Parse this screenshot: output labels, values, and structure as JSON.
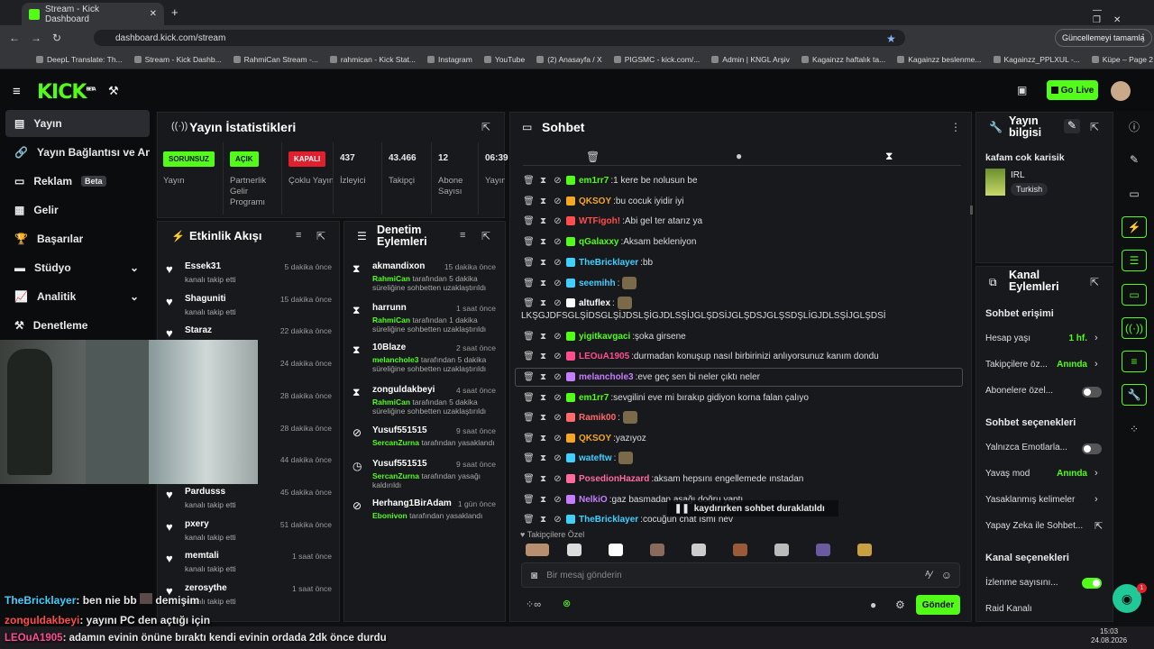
{
  "browser": {
    "tab_title": "Stream - Kick Dashboard",
    "url": "dashboard.kick.com/stream",
    "update_label": "Güncellemeyi tamamla",
    "bookmarks": [
      "DeepL Translate: Th...",
      "Stream - Kick Dashb...",
      "RahmiCan Stream -...",
      "rahmican - Kick Stat...",
      "Instagram",
      "YouTube",
      "(2) Anasayfa / X",
      "PIGSMC - kick.com/...",
      "Admin | KNGL Arşiv",
      "Kagainzz haftalık ta...",
      "Kagainzz beslenme...",
      "Kagainzz_PPLXUL -...",
      "Küpe – Page 2"
    ]
  },
  "kick": {
    "logo": "KICK",
    "beta": "BETA",
    "go_live": "Go Live"
  },
  "sidebar": {
    "items": [
      {
        "label": "Yayın"
      },
      {
        "label": "Yayın Bağlantısı ve Anahtarı"
      },
      {
        "label": "Reklam"
      },
      {
        "label": "Gelir"
      },
      {
        "label": "Başarılar"
      },
      {
        "label": "Stüdyo"
      },
      {
        "label": "Analitik"
      },
      {
        "label": "Denetleme"
      }
    ],
    "beta_badge": "Beta"
  },
  "stats": {
    "title": "Yayın İstatistikleri",
    "cols": [
      {
        "value": "SORUNSUZ",
        "label": "Yayın",
        "color": "#53fc18"
      },
      {
        "value": "AÇIK",
        "label": "Partnerlik Gelir Programı",
        "color": "#53fc18"
      },
      {
        "value": "KAPALI",
        "label": "Çoklu Yayın",
        "color": "#e0202d"
      },
      {
        "value": "437",
        "label": "İzleyici"
      },
      {
        "value": "43.466",
        "label": "Takipçi"
      },
      {
        "value": "12",
        "label": "Abone Sayısı"
      },
      {
        "value": "06:39",
        "label": "Yayın Oldu Süre"
      }
    ]
  },
  "activity": {
    "title": "Etkinlik Akışı",
    "items": [
      {
        "user": "Essek31",
        "action": "kanalı takip etti",
        "time": "5 dakika önce"
      },
      {
        "user": "Shaguniti",
        "action": "kanalı takip etti",
        "time": "15 dakika önce"
      },
      {
        "user": "Staraz",
        "action": "",
        "time": "22 dakika önce"
      },
      {
        "user": "",
        "action": "",
        "time": "24 dakika önce"
      },
      {
        "user": "",
        "action": "",
        "time": "28 dakika önce"
      },
      {
        "user": "",
        "action": "",
        "time": "28 dakika önce"
      },
      {
        "user": "",
        "action": "",
        "time": "44 dakika önce"
      },
      {
        "user": "Pardusss",
        "action": "kanalı takip etti",
        "time": "45 dakika önce"
      },
      {
        "user": "pxery",
        "action": "kanalı takip etti",
        "time": "51 dakika önce"
      },
      {
        "user": "memtali",
        "action": "kanalı takip etti",
        "time": "1 saat önce"
      },
      {
        "user": "zerosythe",
        "action": "kanalı takip etti",
        "time": "1 saat önce"
      }
    ]
  },
  "moderation": {
    "title": "Denetim Eylemleri",
    "items": [
      {
        "user": "akmandixon",
        "by": "RahmiCan",
        "rest": "tarafından 5 dakika süreliğine sohbetten uzaklaştırıldı",
        "time": "15 dakika önce",
        "icon": "⧗"
      },
      {
        "user": "harrunn",
        "by": "RahmiCan",
        "rest": "tarafından 1 dakika süreliğine sohbetten uzaklaştırıldı",
        "time": "1 saat önce",
        "icon": "⧗"
      },
      {
        "user": "10Blaze",
        "by": "melanchole3",
        "rest": "tarafından 5 dakika süreliğine sohbetten uzaklaştırıldı",
        "time": "2 saat önce",
        "icon": "⧗"
      },
      {
        "user": "zonguldakbeyi",
        "by": "RahmiCan",
        "rest": "tarafından 5 dakika süreliğine sohbetten uzaklaştırıldı",
        "time": "4 saat önce",
        "icon": "⧗"
      },
      {
        "user": "Yusuf551515",
        "by": "SercanZurna",
        "rest": "tarafından yasaklandı",
        "time": "9 saat önce",
        "icon": "⊘"
      },
      {
        "user": "Yusuf551515",
        "by": "SercanZurna",
        "rest": "tarafından yasağı kaldırıldı",
        "time": "9 saat önce",
        "icon": "◷"
      },
      {
        "user": "Herhang1BirAdam",
        "by": "Ebonivon",
        "rest": "tarafından yasaklandı",
        "time": "1 gün önce",
        "icon": "⊘"
      }
    ]
  },
  "chat": {
    "title": "Sohbet",
    "messages": [
      {
        "user": "em1rr7",
        "text": "1 kere be nolusun be",
        "color": "#53fc18"
      },
      {
        "user": "QKSOY",
        "text": "bu cocuk iyidir iyi",
        "color": "#f5a623"
      },
      {
        "user": "WTFigoh!",
        "text": "Abi gel ter atarız ya",
        "color": "#ff4d4d"
      },
      {
        "user": "qGalaxxy",
        "text": "Aksam bekleniyon",
        "color": "#53fc18"
      },
      {
        "user": "TheBricklayer",
        "text": "bb",
        "color": "#3fd0ff"
      },
      {
        "user": "seemihh",
        "text": "",
        "color": "#3fd0ff"
      },
      {
        "user": "altuflex",
        "text": "",
        "color": "#ffffff"
      },
      {
        "user": "",
        "text": "LKŞGJDFSGLŞİDSGLŞİJDSLŞİGJDLSŞİJGLŞDSİJGLŞDSJGLŞSDŞLİGJDLSŞİJGLŞDSİ",
        "color": "#ffffff"
      },
      {
        "user": "yigitkavgaci",
        "text": "şoka girsene",
        "color": "#53fc18"
      },
      {
        "user": "LEOuA1905",
        "text": "durmadan konuşup nasıl birbirinizi anlıyorsunuz kanım dondu",
        "color": "#ff4d8d"
      },
      {
        "user": "melanchole3",
        "text": "eve geç sen bi neler çıktı neler",
        "color": "#c77dff"
      },
      {
        "user": "em1rr7",
        "text": "sevgilini eve mi bırakıp gidiyon korna falan çalıyo",
        "color": "#53fc18"
      },
      {
        "user": "Ramik00",
        "text": "",
        "color": "#ff6b6b"
      },
      {
        "user": "QKSOY",
        "text": "yazıyoz",
        "color": "#f5a623"
      },
      {
        "user": "wateftw",
        "text": "",
        "color": "#3fd0ff"
      },
      {
        "user": "PosedionHazard",
        "text": "aksam hepsını engellemede ınstadan",
        "color": "#ff6b9d"
      },
      {
        "user": "NelkiO",
        "text": "gaz basmadan aşağı doğru yaptı",
        "color": "#c77dff"
      },
      {
        "user": "TheBricklayer",
        "text": "cocuğun cnat ısmı nev",
        "color": "#3fd0ff"
      }
    ],
    "paused": "kaydırırken sohbet duraklatıldı",
    "followers_label": "Takipçilere Özel",
    "input_placeholder": "Bir mesaj gönderin",
    "send": "Gönder"
  },
  "info": {
    "title": "Yayın bilgisi",
    "stream_title": "kafam cok karisik",
    "category": "IRL",
    "language": "Turkish"
  },
  "actions": {
    "title": "Kanal Eylemleri",
    "chat_access": "Sohbet erişimi",
    "rows": [
      {
        "label": "Hesap yaşı",
        "value": "1 hf."
      },
      {
        "label": "Takipçilere öz...",
        "value": "Anında"
      },
      {
        "label": "Abonelere özel...",
        "value": ""
      }
    ],
    "chat_options": "Sohbet seçenekleri",
    "rows2": [
      {
        "label": "Yalnızca Emotlarla...",
        "value": ""
      },
      {
        "label": "Yavaş mod",
        "value": "Anında"
      },
      {
        "label": "Yasaklanmış kelimeler",
        "value": ""
      },
      {
        "label": "Yapay Zeka ile Sohbet...",
        "value": ""
      }
    ],
    "channel_options": "Kanal seçenekleri",
    "rows3": [
      {
        "label": "İzlenme sayısını..."
      },
      {
        "label": "Raid Kanalı"
      }
    ],
    "notif_count": "1"
  },
  "overlay": [
    {
      "user": "TheBricklayer",
      "text": ": ben nie bb",
      "extra": "demişim",
      "color": "#3fd0ff"
    },
    {
      "user": "zonguldakbeyi",
      "text": ": yayını PC den açtığı için",
      "color": "#ff4d4d"
    },
    {
      "user": "LEOuA1905",
      "text": ": adamın evinin önüne bıraktı kendi evinin ordada 2dk önce durdu",
      "color": "#ff4d8d"
    }
  ],
  "taskbar": {
    "time": "15:03",
    "date": "24.08.2026"
  }
}
